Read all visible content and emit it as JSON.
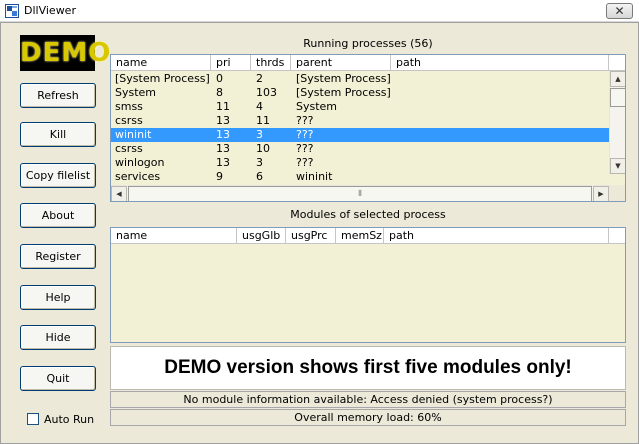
{
  "window": {
    "title": "DllViewer",
    "close_glyph": "✕"
  },
  "logo": {
    "text": "DEMO",
    "color": "#d9c800"
  },
  "buttons": {
    "refresh": "Refresh",
    "kill": "Kill",
    "copy_filelist": "Copy filelist",
    "about": "About",
    "register": "Register",
    "help": "Help",
    "hide": "Hide",
    "quit": "Quit"
  },
  "auto_run": {
    "label": "Auto Run",
    "checked": false
  },
  "processes": {
    "title": "Running processes (56)",
    "columns": [
      "name",
      "pri",
      "thrds",
      "parent",
      "path"
    ],
    "rows": [
      [
        "[System Process]",
        "0",
        "2",
        "[System Process]",
        ""
      ],
      [
        "System",
        "8",
        "103",
        "[System Process]",
        ""
      ],
      [
        "smss",
        "11",
        "4",
        "System",
        ""
      ],
      [
        "csrss",
        "13",
        "11",
        "???",
        ""
      ],
      [
        "wininit",
        "13",
        "3",
        "???",
        ""
      ],
      [
        "csrss",
        "13",
        "10",
        "???",
        ""
      ],
      [
        "winlogon",
        "13",
        "3",
        "???",
        ""
      ],
      [
        "services",
        "9",
        "6",
        "wininit",
        ""
      ]
    ],
    "selected_index": 4,
    "selection_color": "#3399ff"
  },
  "modules": {
    "title": "Modules of selected process",
    "columns": [
      "name",
      "usgGlb",
      "usgPrc",
      "memSz",
      "path"
    ]
  },
  "demo_notice": "DEMO version shows first five modules only!",
  "status": {
    "module_info": "No module information available: Access denied (system process?)",
    "memory_load": "Overall memory load: 60%"
  }
}
